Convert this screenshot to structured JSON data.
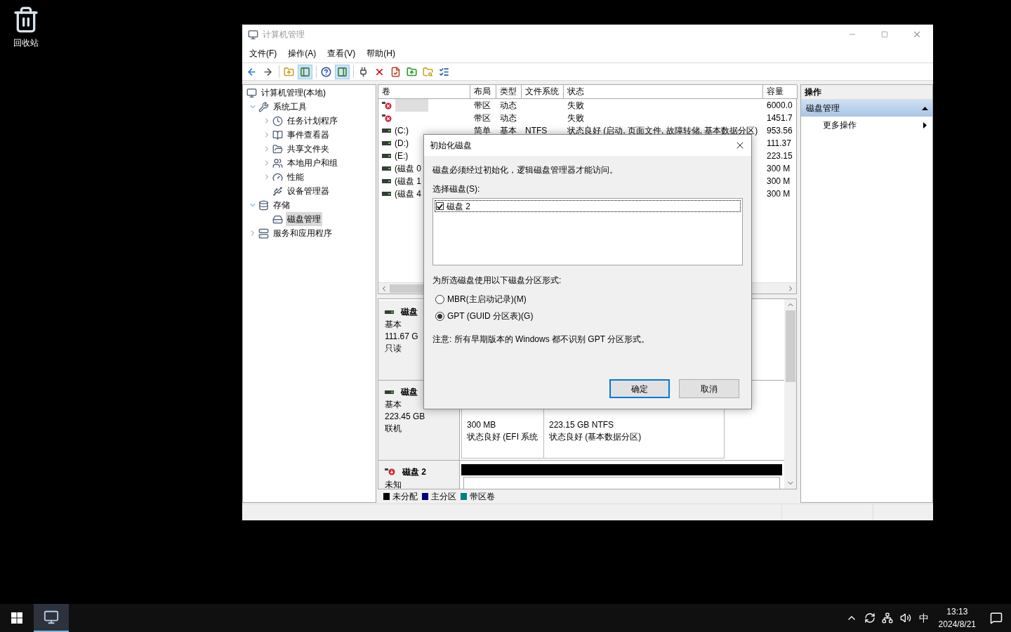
{
  "desktop_icons": [
    {
      "label": "回收站"
    }
  ],
  "window": {
    "title": "计算机管理",
    "active": false
  },
  "menu": [
    "文件(F)",
    "操作(A)",
    "查看(V)",
    "帮助(H)"
  ],
  "toolbar": [
    [
      {
        "pressed": false
      },
      {
        "pressed": false
      }
    ],
    [
      {
        "pressed": false
      },
      {
        "pressed": true
      }
    ],
    [
      {
        "pressed": false
      },
      {
        "pressed": true
      }
    ],
    [
      {
        "pressed": false
      },
      {
        "pressed": false
      },
      {
        "pressed": false
      },
      {
        "pressed": false
      },
      {
        "pressed": false
      },
      {
        "pressed": false
      }
    ]
  ],
  "tree": {
    "label": "计算机管理(本地)",
    "selected": false,
    "children": [
      {
        "label": "系统工具",
        "selected": false,
        "expanded": true,
        "children": [
          {
            "label": "任务计划程序",
            "selected": false,
            "expanded": false
          },
          {
            "label": "事件查看器",
            "selected": false,
            "expanded": false
          },
          {
            "label": "共享文件夹",
            "selected": false,
            "expanded": false
          },
          {
            "label": "本地用户和组",
            "selected": false,
            "expanded": false
          },
          {
            "label": "性能",
            "selected": false,
            "expanded": false
          },
          {
            "label": "设备管理器",
            "selected": false
          }
        ]
      },
      {
        "label": "存储",
        "selected": false,
        "expanded": true,
        "children": [
          {
            "label": "磁盘管理",
            "selected": true
          }
        ]
      },
      {
        "label": "服务和应用程序",
        "selected": false,
        "expanded": false
      }
    ]
  },
  "volumes": {
    "columns": [
      "卷",
      "布局",
      "类型",
      "文件系统",
      "状态",
      "容量"
    ],
    "rows": [
      {
        "failed": true,
        "selected": true,
        "layout": "带区",
        "type": "动态",
        "status": "失败",
        "capacity": "6000.0"
      },
      {
        "failed": true,
        "selected": false,
        "layout": "带区",
        "type": "动态",
        "status": "失败",
        "capacity": "1451.7"
      },
      {
        "failed": false,
        "selected": false,
        "volume": "(C:)",
        "layout": "简单",
        "type": "基本",
        "filesystem": "NTFS",
        "status": "状态良好 (启动, 页面文件, 故障转储, 基本数据分区)",
        "capacity": "953.56"
      },
      {
        "failed": false,
        "selected": false,
        "volume": "(D:)",
        "capacity": "111.37"
      },
      {
        "failed": false,
        "selected": false,
        "volume": "(E:)",
        "capacity": "223.15"
      },
      {
        "failed": false,
        "selected": false,
        "volume": "(磁盘 0",
        "capacity": "300 M"
      },
      {
        "failed": false,
        "selected": false,
        "volume": "(磁盘 1",
        "capacity": "300 M"
      },
      {
        "failed": false,
        "selected": false,
        "volume": "(磁盘 4",
        "capacity": "300 M"
      }
    ]
  },
  "disks": [
    {
      "kind": "basic",
      "name": "磁盘",
      "type": "基本",
      "size": "111.67 G",
      "state": "只读"
    },
    {
      "kind": "basic",
      "name": "磁盘",
      "type": "基本",
      "size": "223.45 GB",
      "state": "联机",
      "partitions": [
        {
          "size": "300 MB",
          "status": "状态良好 (EFI 系统"
        },
        {
          "size": "223.15 GB NTFS",
          "status": "状态良好 (基本数据分区)"
        }
      ]
    },
    {
      "kind": "unknown",
      "name": "磁盘 2",
      "type": "未知"
    }
  ],
  "legend": [
    {
      "label": "未分配",
      "color": "#000000"
    },
    {
      "label": "主分区",
      "color": "#000080"
    },
    {
      "label": "带区卷",
      "color": "#008080"
    }
  ],
  "actions": {
    "title": "操作",
    "sections": [
      {
        "label": "磁盘管理",
        "expanded": true,
        "items": [
          "更多操作"
        ]
      }
    ]
  },
  "dialog": {
    "title": "初始化磁盘",
    "message": "磁盘必须经过初始化，逻辑磁盘管理器才能访问。",
    "select_label": "选择磁盘(S):",
    "disks": [
      {
        "label": "磁盘 2",
        "checked": true
      }
    ],
    "style_label": "为所选磁盘使用以下磁盘分区形式:",
    "options": [
      {
        "label": "MBR(主启动记录)(M)",
        "selected": false
      },
      {
        "label": "GPT (GUID 分区表)(G)",
        "selected": true
      }
    ],
    "note": "注意: 所有早期版本的 Windows 都不识别 GPT 分区形式。",
    "buttons": [
      {
        "label": "确定",
        "default": true
      },
      {
        "label": "取消",
        "default": false
      }
    ]
  },
  "taskbar": {
    "apps": [
      {
        "selected": true
      }
    ],
    "ime": "中",
    "time": "13:13",
    "date": "2024/8/21"
  }
}
